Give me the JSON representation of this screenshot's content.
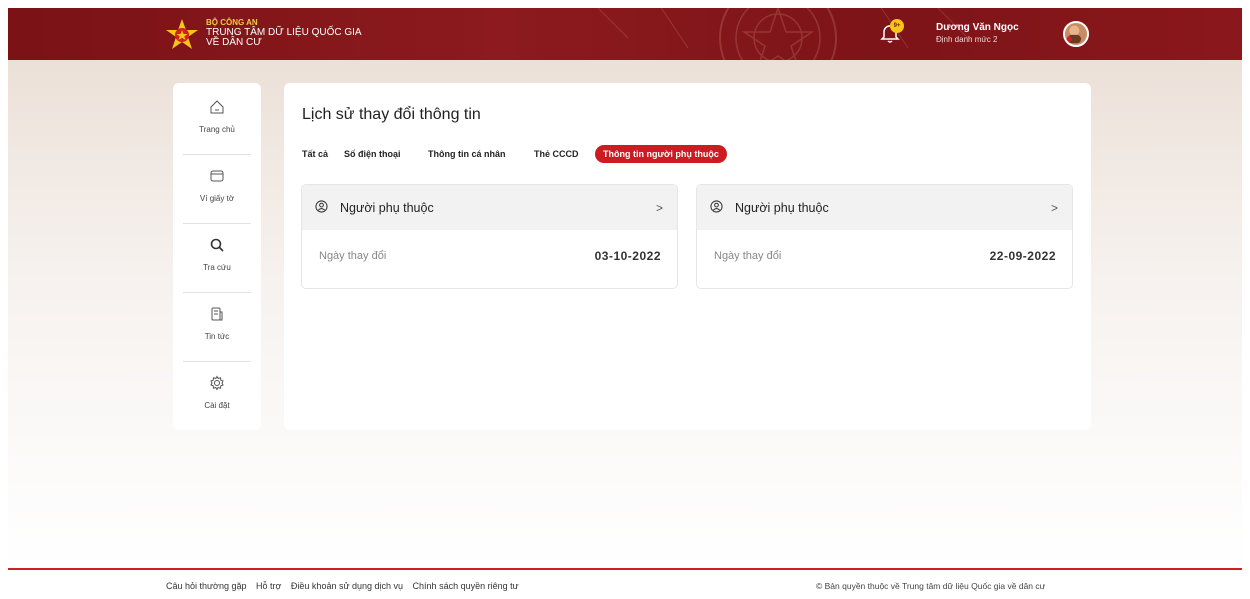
{
  "header": {
    "org_line1": "BỘ CÔNG AN",
    "org_line2": "TRUNG TÂM DỮ LIỆU QUỐC GIA",
    "org_line3": "VỀ DÂN CƯ",
    "notification_badge": "9+",
    "user_name": "Dương Văn Ngọc",
    "user_level": "Định danh mức 2",
    "brand_color": "#7a1216"
  },
  "sidebar": {
    "items": [
      {
        "label": "Trang chủ",
        "icon": "home-icon"
      },
      {
        "label": "Ví giấy tờ",
        "icon": "wallet-icon"
      },
      {
        "label": "Tra cứu",
        "icon": "search-icon"
      },
      {
        "label": "Tin tức",
        "icon": "news-icon"
      },
      {
        "label": "Cài đặt",
        "icon": "gear-icon"
      }
    ]
  },
  "main": {
    "title": "Lịch sử thay đổi thông tin",
    "tabs": [
      {
        "label": "Tất cả"
      },
      {
        "label": "Số điện thoại"
      },
      {
        "label": "Thông tin cá nhân"
      },
      {
        "label": "Thẻ CCCD"
      },
      {
        "label": "Thông tin người phụ thuộc",
        "active": true
      }
    ],
    "cards": [
      {
        "title": "Người phụ thuộc",
        "field_label": "Ngày thay đổi",
        "date": "03-10-2022"
      },
      {
        "title": "Người phụ thuộc",
        "field_label": "Ngày thay đổi",
        "date": "22-09-2022"
      }
    ],
    "accent_color": "#cc1b22"
  },
  "footer": {
    "links": [
      "Câu hỏi thường gặp",
      "Hỗ trợ",
      "Điều khoản sử dụng dịch vụ",
      "Chính sách quyền riêng tư"
    ],
    "copyright": "© Bản quyền thuộc về Trung tâm dữ liệu Quốc gia về dân cư"
  }
}
